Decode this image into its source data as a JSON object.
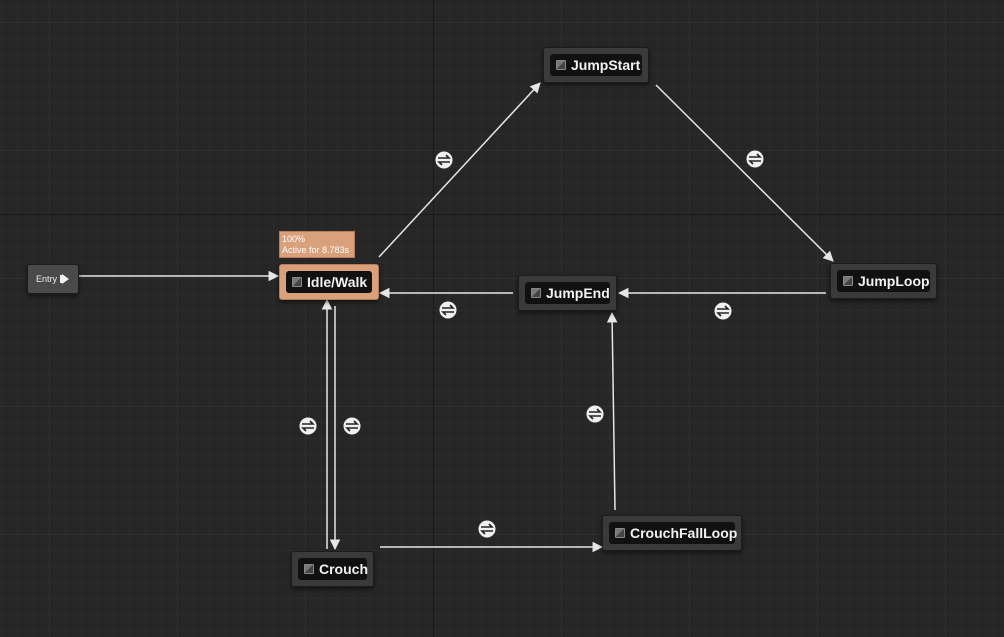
{
  "entry": {
    "label": "Entry"
  },
  "tooltip": {
    "weight": "100%",
    "active_time": "Active for 8.783s"
  },
  "states": {
    "idle_walk": {
      "label": "Idle/Walk"
    },
    "jump_start": {
      "label": "JumpStart"
    },
    "jump_loop": {
      "label": "JumpLoop"
    },
    "jump_end": {
      "label": "JumpEnd"
    },
    "crouch": {
      "label": "Crouch"
    },
    "crouch_fall_loop": {
      "label": "CrouchFallLoop"
    }
  },
  "colors": {
    "background": "#262626",
    "node": "#3a3a3a",
    "active_node": "#d9a07c",
    "transition_line": "#e6e6e6"
  },
  "icons": {
    "state": "state-icon",
    "transition": "transition-rule-icon",
    "entry": "entry-arrow-icon"
  }
}
